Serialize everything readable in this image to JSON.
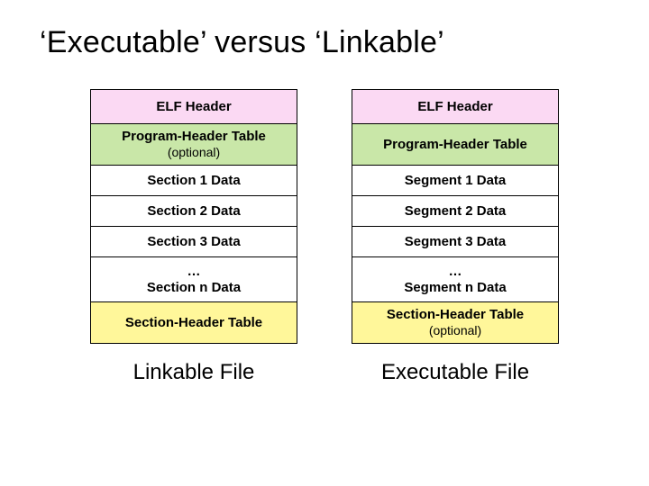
{
  "title": "‘Executable’ versus ‘Linkable’",
  "left": {
    "caption": "Linkable File",
    "rows": [
      {
        "line1": "ELF Header",
        "line2": ""
      },
      {
        "line1": "Program-Header Table",
        "line2": "(optional)"
      },
      {
        "line1": "Section 1 Data",
        "line2": ""
      },
      {
        "line1": "Section 2 Data",
        "line2": ""
      },
      {
        "line1": "Section 3 Data",
        "line2": ""
      },
      {
        "line1": "…",
        "line2": "Section n Data"
      },
      {
        "line1": "Section-Header Table",
        "line2": ""
      }
    ]
  },
  "right": {
    "caption": "Executable File",
    "rows": [
      {
        "line1": "ELF Header",
        "line2": ""
      },
      {
        "line1": "Program-Header Table",
        "line2": ""
      },
      {
        "line1": "Segment 1 Data",
        "line2": ""
      },
      {
        "line1": "Segment 2 Data",
        "line2": ""
      },
      {
        "line1": "Segment 3 Data",
        "line2": ""
      },
      {
        "line1": "…",
        "line2": "Segment n Data"
      },
      {
        "line1": "Section-Header Table",
        "line2": "(optional)"
      }
    ]
  }
}
